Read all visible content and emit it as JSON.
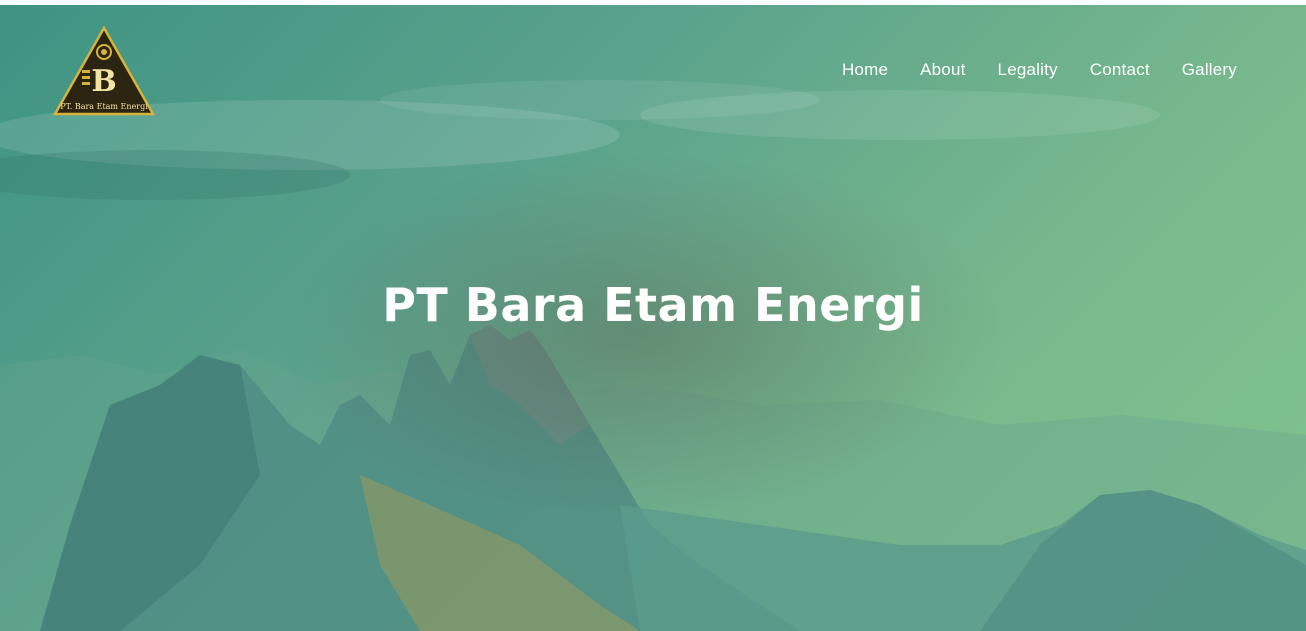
{
  "brand": {
    "logo_text": "PT. Bara Etam Energi",
    "logo_letter": "B",
    "colors": {
      "gold": "#d6b33b",
      "dark": "#2b2410"
    }
  },
  "nav": {
    "items": [
      {
        "label": "Home"
      },
      {
        "label": "About"
      },
      {
        "label": "Legality"
      },
      {
        "label": "Contact"
      },
      {
        "label": "Gallery"
      }
    ]
  },
  "hero": {
    "title": "PT Bara Etam Energi",
    "overlay_colors": {
      "start": "#3f9383",
      "end": "#7fc58f"
    }
  }
}
